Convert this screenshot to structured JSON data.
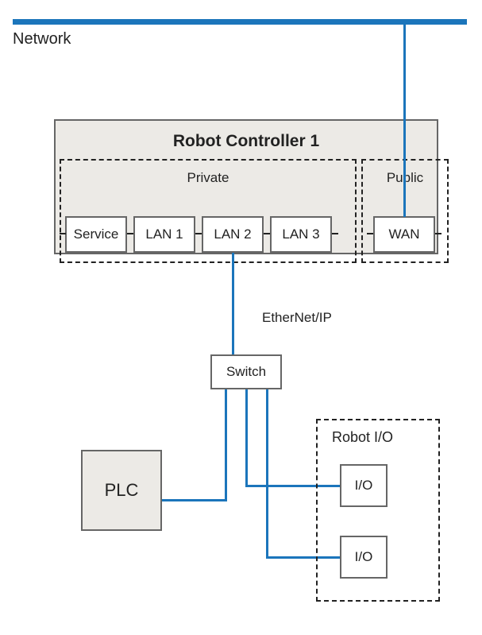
{
  "network_label": "Network",
  "controller": {
    "title": "Robot Controller 1",
    "private_label": "Private",
    "public_label": "Public",
    "ports": {
      "service": "Service",
      "lan1": "LAN 1",
      "lan2": "LAN 2",
      "lan3": "LAN 3",
      "wan": "WAN"
    }
  },
  "link_label": "EtherNet/IP",
  "switch_label": "Switch",
  "plc_label": "PLC",
  "robot_io": {
    "group_label": "Robot I/O",
    "io1": "I/O",
    "io2": "I/O"
  },
  "colors": {
    "wire": "#1b75bb",
    "box_fill": "#eceae6",
    "box_border": "#666666"
  }
}
